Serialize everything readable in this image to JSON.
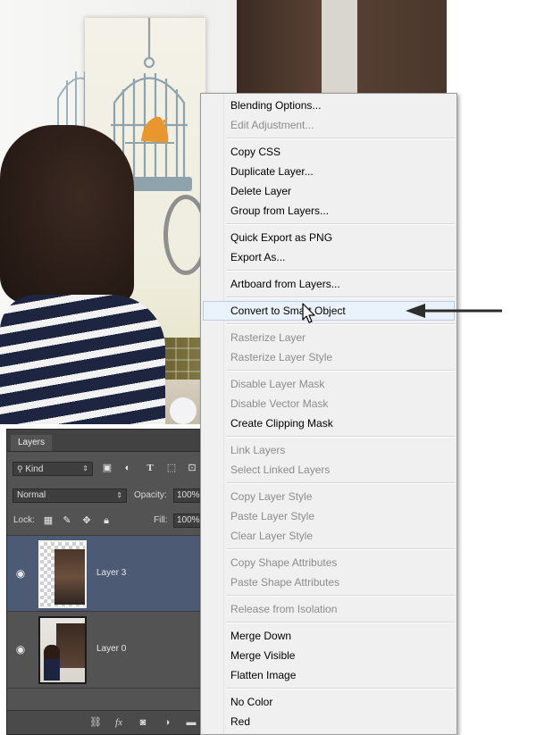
{
  "layers_panel": {
    "tab": "Layers",
    "filter": {
      "label": "Kind",
      "icons": [
        "image-filter-icon",
        "adjustment-filter-icon",
        "type-filter-icon",
        "shape-filter-icon",
        "smart-object-filter-icon"
      ]
    },
    "blend_mode": "Normal",
    "opacity_label": "Opacity:",
    "opacity_value": "100%",
    "lock_label": "Lock:",
    "fill_label": "Fill:",
    "fill_value": "100%",
    "layers": [
      {
        "name": "Layer 3",
        "visible": true,
        "selected": true
      },
      {
        "name": "Layer 0",
        "visible": true,
        "selected": false
      }
    ],
    "footer_icons": [
      "link-layers-icon",
      "fx-icon",
      "add-mask-icon",
      "new-adjustment-icon",
      "new-group-icon"
    ],
    "fx_label": "fx"
  },
  "context_menu": {
    "items": [
      {
        "label": "Blending Options...",
        "enabled": true
      },
      {
        "label": "Edit Adjustment...",
        "enabled": false
      },
      {
        "label": "Copy CSS",
        "enabled": true
      },
      {
        "label": "Duplicate Layer...",
        "enabled": true
      },
      {
        "label": "Delete Layer",
        "enabled": true
      },
      {
        "label": "Group from Layers...",
        "enabled": true
      },
      {
        "label": "Quick Export as PNG",
        "enabled": true
      },
      {
        "label": "Export As...",
        "enabled": true
      },
      {
        "label": "Artboard from Layers...",
        "enabled": true
      },
      {
        "label": "Convert to Smart Object",
        "enabled": true,
        "highlighted": true
      },
      {
        "label": "Rasterize Layer",
        "enabled": false
      },
      {
        "label": "Rasterize Layer Style",
        "enabled": false
      },
      {
        "label": "Disable Layer Mask",
        "enabled": false
      },
      {
        "label": "Disable Vector Mask",
        "enabled": false
      },
      {
        "label": "Create Clipping Mask",
        "enabled": true
      },
      {
        "label": "Link Layers",
        "enabled": false
      },
      {
        "label": "Select Linked Layers",
        "enabled": false
      },
      {
        "label": "Copy Layer Style",
        "enabled": false
      },
      {
        "label": "Paste Layer Style",
        "enabled": false
      },
      {
        "label": "Clear Layer Style",
        "enabled": false
      },
      {
        "label": "Copy Shape Attributes",
        "enabled": false
      },
      {
        "label": "Paste Shape Attributes",
        "enabled": false
      },
      {
        "label": "Release from Isolation",
        "enabled": false
      },
      {
        "label": "Merge Down",
        "enabled": true
      },
      {
        "label": "Merge Visible",
        "enabled": true
      },
      {
        "label": "Flatten Image",
        "enabled": true
      },
      {
        "label": "No Color",
        "enabled": true
      },
      {
        "label": "Red",
        "enabled": true
      }
    ]
  },
  "colors": {
    "menu_bg": "#f0f0f0",
    "menu_highlight": "#e9f1fb",
    "panel_bg": "#535353",
    "selected_layer": "#4d5a74",
    "bird": "#e8962e",
    "birdcage": "#8fa3ad"
  }
}
